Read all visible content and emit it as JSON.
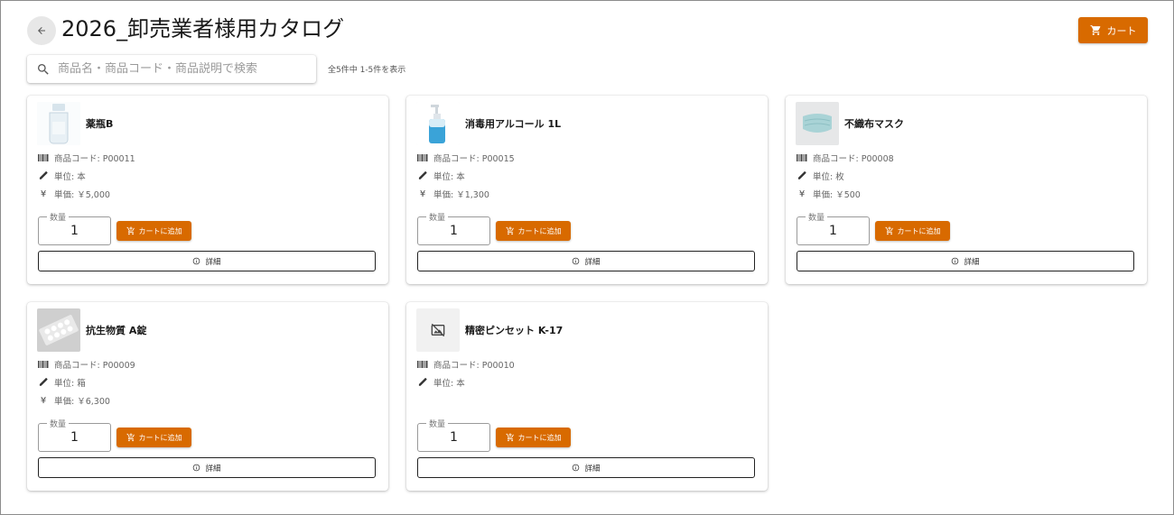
{
  "header": {
    "title": "2026_卸売業者様用カタログ",
    "cart_label": "カート"
  },
  "search": {
    "placeholder": "商品名・商品コード・商品説明で検索",
    "value": "",
    "result_count": "全5件中 1-5件を表示"
  },
  "labels": {
    "quantity": "数量",
    "add_to_cart": "カートに追加",
    "detail": "詳細"
  },
  "products": [
    {
      "name": "薬瓶B",
      "code": "商品コード: P00011",
      "unit": "単位: 本",
      "price": "単価: ￥5,000",
      "quantity": "1",
      "image": "medicine-bottle"
    },
    {
      "name": "消毒用アルコール 1L",
      "code": "商品コード: P00015",
      "unit": "単位: 本",
      "price": "単価: ￥1,300",
      "quantity": "1",
      "image": "pump-bottle"
    },
    {
      "name": "不織布マスク",
      "code": "商品コード: P00008",
      "unit": "単位: 枚",
      "price": "単価: ￥500",
      "quantity": "1",
      "image": "face-mask"
    },
    {
      "name": "抗生物質 A錠",
      "code": "商品コード: P00009",
      "unit": "単位: 箱",
      "price": "単価: ￥6,300",
      "quantity": "1",
      "image": "pill-blister"
    },
    {
      "name": "精密ピンセット K-17",
      "code": "商品コード: P00010",
      "unit": "単位: 本",
      "price": "",
      "quantity": "1",
      "image": "image-placeholder"
    }
  ],
  "colors": {
    "accent": "#d86a00",
    "text": "#1a1a1a",
    "muted": "#666666"
  }
}
